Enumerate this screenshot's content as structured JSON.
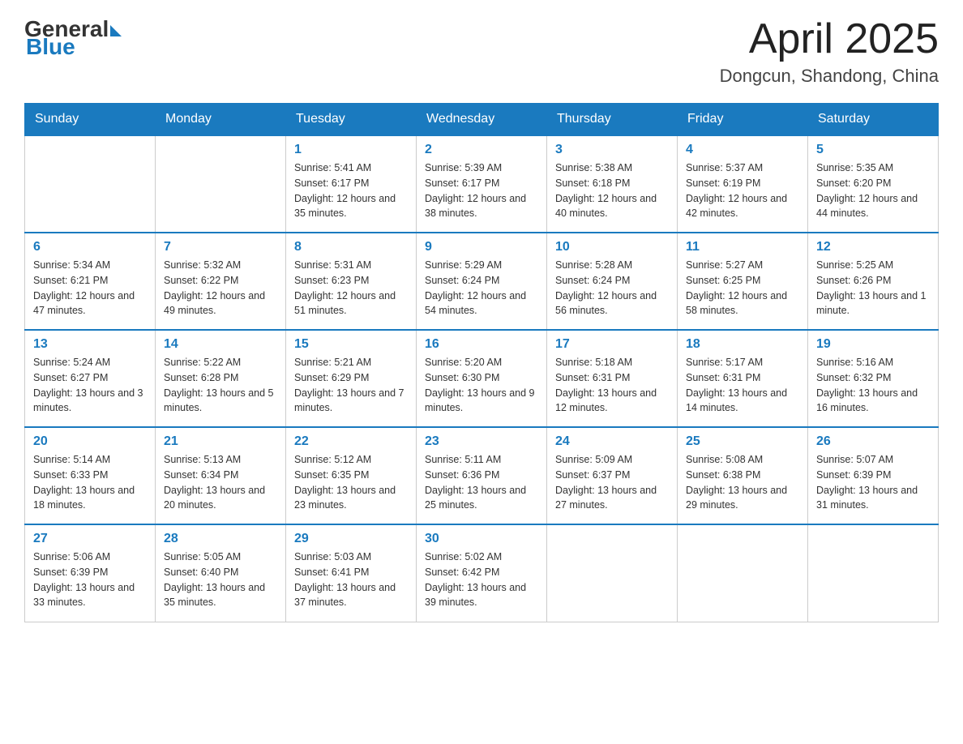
{
  "header": {
    "logo_general": "General",
    "logo_blue": "Blue",
    "month_title": "April 2025",
    "location": "Dongcun, Shandong, China"
  },
  "days_of_week": [
    "Sunday",
    "Monday",
    "Tuesday",
    "Wednesday",
    "Thursday",
    "Friday",
    "Saturday"
  ],
  "weeks": [
    [
      {
        "day": "",
        "sunrise": "",
        "sunset": "",
        "daylight": ""
      },
      {
        "day": "",
        "sunrise": "",
        "sunset": "",
        "daylight": ""
      },
      {
        "day": "1",
        "sunrise": "Sunrise: 5:41 AM",
        "sunset": "Sunset: 6:17 PM",
        "daylight": "Daylight: 12 hours and 35 minutes."
      },
      {
        "day": "2",
        "sunrise": "Sunrise: 5:39 AM",
        "sunset": "Sunset: 6:17 PM",
        "daylight": "Daylight: 12 hours and 38 minutes."
      },
      {
        "day": "3",
        "sunrise": "Sunrise: 5:38 AM",
        "sunset": "Sunset: 6:18 PM",
        "daylight": "Daylight: 12 hours and 40 minutes."
      },
      {
        "day": "4",
        "sunrise": "Sunrise: 5:37 AM",
        "sunset": "Sunset: 6:19 PM",
        "daylight": "Daylight: 12 hours and 42 minutes."
      },
      {
        "day": "5",
        "sunrise": "Sunrise: 5:35 AM",
        "sunset": "Sunset: 6:20 PM",
        "daylight": "Daylight: 12 hours and 44 minutes."
      }
    ],
    [
      {
        "day": "6",
        "sunrise": "Sunrise: 5:34 AM",
        "sunset": "Sunset: 6:21 PM",
        "daylight": "Daylight: 12 hours and 47 minutes."
      },
      {
        "day": "7",
        "sunrise": "Sunrise: 5:32 AM",
        "sunset": "Sunset: 6:22 PM",
        "daylight": "Daylight: 12 hours and 49 minutes."
      },
      {
        "day": "8",
        "sunrise": "Sunrise: 5:31 AM",
        "sunset": "Sunset: 6:23 PM",
        "daylight": "Daylight: 12 hours and 51 minutes."
      },
      {
        "day": "9",
        "sunrise": "Sunrise: 5:29 AM",
        "sunset": "Sunset: 6:24 PM",
        "daylight": "Daylight: 12 hours and 54 minutes."
      },
      {
        "day": "10",
        "sunrise": "Sunrise: 5:28 AM",
        "sunset": "Sunset: 6:24 PM",
        "daylight": "Daylight: 12 hours and 56 minutes."
      },
      {
        "day": "11",
        "sunrise": "Sunrise: 5:27 AM",
        "sunset": "Sunset: 6:25 PM",
        "daylight": "Daylight: 12 hours and 58 minutes."
      },
      {
        "day": "12",
        "sunrise": "Sunrise: 5:25 AM",
        "sunset": "Sunset: 6:26 PM",
        "daylight": "Daylight: 13 hours and 1 minute."
      }
    ],
    [
      {
        "day": "13",
        "sunrise": "Sunrise: 5:24 AM",
        "sunset": "Sunset: 6:27 PM",
        "daylight": "Daylight: 13 hours and 3 minutes."
      },
      {
        "day": "14",
        "sunrise": "Sunrise: 5:22 AM",
        "sunset": "Sunset: 6:28 PM",
        "daylight": "Daylight: 13 hours and 5 minutes."
      },
      {
        "day": "15",
        "sunrise": "Sunrise: 5:21 AM",
        "sunset": "Sunset: 6:29 PM",
        "daylight": "Daylight: 13 hours and 7 minutes."
      },
      {
        "day": "16",
        "sunrise": "Sunrise: 5:20 AM",
        "sunset": "Sunset: 6:30 PM",
        "daylight": "Daylight: 13 hours and 9 minutes."
      },
      {
        "day": "17",
        "sunrise": "Sunrise: 5:18 AM",
        "sunset": "Sunset: 6:31 PM",
        "daylight": "Daylight: 13 hours and 12 minutes."
      },
      {
        "day": "18",
        "sunrise": "Sunrise: 5:17 AM",
        "sunset": "Sunset: 6:31 PM",
        "daylight": "Daylight: 13 hours and 14 minutes."
      },
      {
        "day": "19",
        "sunrise": "Sunrise: 5:16 AM",
        "sunset": "Sunset: 6:32 PM",
        "daylight": "Daylight: 13 hours and 16 minutes."
      }
    ],
    [
      {
        "day": "20",
        "sunrise": "Sunrise: 5:14 AM",
        "sunset": "Sunset: 6:33 PM",
        "daylight": "Daylight: 13 hours and 18 minutes."
      },
      {
        "day": "21",
        "sunrise": "Sunrise: 5:13 AM",
        "sunset": "Sunset: 6:34 PM",
        "daylight": "Daylight: 13 hours and 20 minutes."
      },
      {
        "day": "22",
        "sunrise": "Sunrise: 5:12 AM",
        "sunset": "Sunset: 6:35 PM",
        "daylight": "Daylight: 13 hours and 23 minutes."
      },
      {
        "day": "23",
        "sunrise": "Sunrise: 5:11 AM",
        "sunset": "Sunset: 6:36 PM",
        "daylight": "Daylight: 13 hours and 25 minutes."
      },
      {
        "day": "24",
        "sunrise": "Sunrise: 5:09 AM",
        "sunset": "Sunset: 6:37 PM",
        "daylight": "Daylight: 13 hours and 27 minutes."
      },
      {
        "day": "25",
        "sunrise": "Sunrise: 5:08 AM",
        "sunset": "Sunset: 6:38 PM",
        "daylight": "Daylight: 13 hours and 29 minutes."
      },
      {
        "day": "26",
        "sunrise": "Sunrise: 5:07 AM",
        "sunset": "Sunset: 6:39 PM",
        "daylight": "Daylight: 13 hours and 31 minutes."
      }
    ],
    [
      {
        "day": "27",
        "sunrise": "Sunrise: 5:06 AM",
        "sunset": "Sunset: 6:39 PM",
        "daylight": "Daylight: 13 hours and 33 minutes."
      },
      {
        "day": "28",
        "sunrise": "Sunrise: 5:05 AM",
        "sunset": "Sunset: 6:40 PM",
        "daylight": "Daylight: 13 hours and 35 minutes."
      },
      {
        "day": "29",
        "sunrise": "Sunrise: 5:03 AM",
        "sunset": "Sunset: 6:41 PM",
        "daylight": "Daylight: 13 hours and 37 minutes."
      },
      {
        "day": "30",
        "sunrise": "Sunrise: 5:02 AM",
        "sunset": "Sunset: 6:42 PM",
        "daylight": "Daylight: 13 hours and 39 minutes."
      },
      {
        "day": "",
        "sunrise": "",
        "sunset": "",
        "daylight": ""
      },
      {
        "day": "",
        "sunrise": "",
        "sunset": "",
        "daylight": ""
      },
      {
        "day": "",
        "sunrise": "",
        "sunset": "",
        "daylight": ""
      }
    ]
  ]
}
